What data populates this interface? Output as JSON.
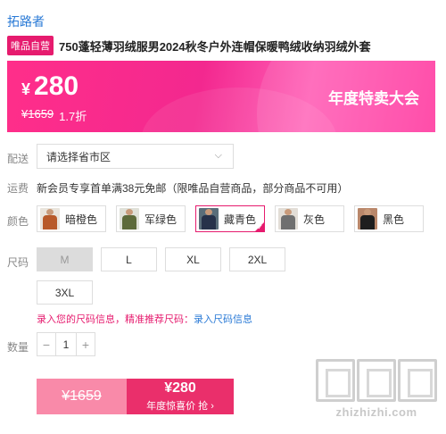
{
  "header": {
    "brand": "拓路者",
    "badge": "唯品自营",
    "title": "750蓬轻薄羽绒服男2024秋冬户外连帽保暖鸭绒收纳羽绒外套"
  },
  "price": {
    "currency": "¥",
    "current": "280",
    "original": "¥1659",
    "discount": "1.7折",
    "event": "年度特卖大会"
  },
  "delivery": {
    "label": "配送",
    "placeholder": "请选择省市区"
  },
  "shipping": {
    "label": "运费",
    "text": "新会员专享首单满38元免邮（限唯品自营商品，部分商品不可用）"
  },
  "color": {
    "label": "颜色",
    "options": [
      {
        "name": "暗橙色",
        "swatch": "#b85a2a",
        "selected": false
      },
      {
        "name": "军绿色",
        "swatch": "#5d6a3a",
        "selected": false
      },
      {
        "name": "藏青色",
        "swatch": "#27324a",
        "selected": true
      },
      {
        "name": "灰色",
        "swatch": "#6f6f6f",
        "selected": false
      },
      {
        "name": "黑色",
        "swatch": "#1e1e1e",
        "selected": false
      }
    ]
  },
  "size": {
    "label": "尺码",
    "options": [
      "M",
      "L",
      "XL",
      "2XL",
      "3XL"
    ],
    "tip": "录入您的尺码信息，精准推荐尺码：",
    "tip_link": "录入尺码信息"
  },
  "quantity": {
    "label": "数量",
    "value": "1",
    "minus": "−",
    "plus": "+"
  },
  "buy": {
    "original": "¥1659",
    "price": "¥280",
    "action": "年度惊喜价 抢 ›"
  },
  "watermark": {
    "url": "zhizhizhi.com"
  },
  "colors": {
    "accent": "#e61b6e",
    "link": "#2a7ad6",
    "banner": "#ff2e8a"
  }
}
